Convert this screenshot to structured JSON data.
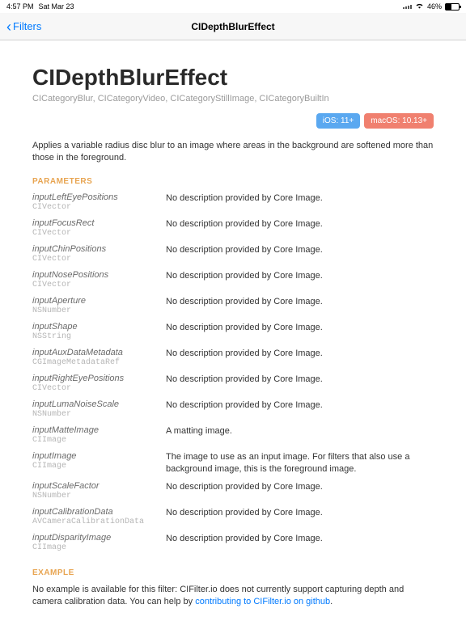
{
  "status": {
    "time": "4:57 PM",
    "date": "Sat Mar 23",
    "battery": "46%"
  },
  "nav": {
    "back_label": "Filters",
    "title": "CIDepthBlurEffect"
  },
  "page": {
    "title": "CIDepthBlurEffect",
    "categories": "CICategoryBlur, CICategoryVideo, CICategoryStillImage, CICategoryBuiltIn",
    "badge_ios": "iOS: 11+",
    "badge_macos": "macOS: 10.13+",
    "description": "Applies a variable radius disc blur to an image where areas in the background are softened more than those in the foreground."
  },
  "headers": {
    "parameters": "PARAMETERS",
    "example": "EXAMPLE"
  },
  "parameters": [
    {
      "name": "inputLeftEyePositions",
      "type": "CIVector",
      "desc": "No description provided by Core Image."
    },
    {
      "name": "inputFocusRect",
      "type": "CIVector",
      "desc": "No description provided by Core Image."
    },
    {
      "name": "inputChinPositions",
      "type": "CIVector",
      "desc": "No description provided by Core Image."
    },
    {
      "name": "inputNosePositions",
      "type": "CIVector",
      "desc": "No description provided by Core Image."
    },
    {
      "name": "inputAperture",
      "type": "NSNumber",
      "desc": "No description provided by Core Image."
    },
    {
      "name": "inputShape",
      "type": "NSString",
      "desc": "No description provided by Core Image."
    },
    {
      "name": "inputAuxDataMetadata",
      "type": "CGImageMetadataRef",
      "desc": "No description provided by Core Image."
    },
    {
      "name": "inputRightEyePositions",
      "type": "CIVector",
      "desc": "No description provided by Core Image."
    },
    {
      "name": "inputLumaNoiseScale",
      "type": "NSNumber",
      "desc": "No description provided by Core Image."
    },
    {
      "name": "inputMatteImage",
      "type": "CIImage",
      "desc": "A matting image."
    },
    {
      "name": "inputImage",
      "type": "CIImage",
      "desc": "The image to use as an input image. For filters that also use a background image, this is the foreground image."
    },
    {
      "name": "inputScaleFactor",
      "type": "NSNumber",
      "desc": "No description provided by Core Image."
    },
    {
      "name": "inputCalibrationData",
      "type": "AVCameraCalibrationData",
      "desc": "No description provided by Core Image."
    },
    {
      "name": "inputDisparityImage",
      "type": "CIImage",
      "desc": "No description provided by Core Image."
    }
  ],
  "example": {
    "text_prefix": "No example is available for this filter: CIFilter.io does not currently support capturing depth and camera calibration data. You can help by ",
    "link_text": "contributing to CIFilter.io on github",
    "text_suffix": "."
  }
}
